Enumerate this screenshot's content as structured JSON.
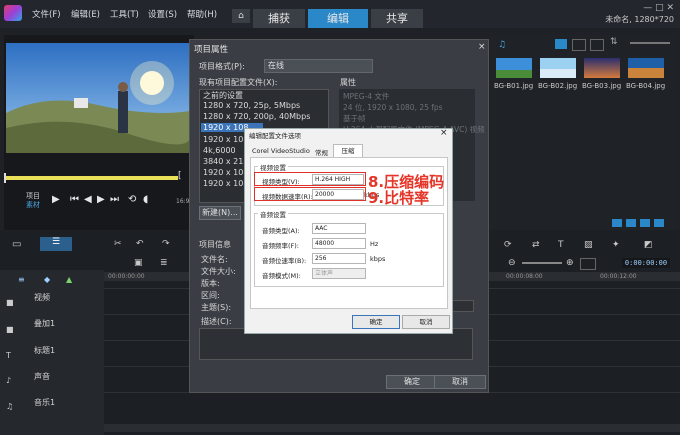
{
  "menubar": {
    "file": "文件(F)",
    "edit": "编辑(E)",
    "tools": "工具(T)",
    "settings": "设置(S)",
    "help": "帮助(H)"
  },
  "tabs": [
    {
      "label": "捕获"
    },
    {
      "label": "编辑"
    },
    {
      "label": "共享"
    }
  ],
  "project_name": "未命名, 1280*720",
  "window_controls": "— □ ✕",
  "preview": {
    "project_label": "项目",
    "clip_label": "素材",
    "time": "16:9"
  },
  "library": {
    "thumbs": [
      {
        "label": "BG-B01.jpg"
      },
      {
        "label": "BG-B02.jpg"
      },
      {
        "label": "BG-B03.jpg"
      },
      {
        "label": "BG-B04.jpg"
      }
    ],
    "timecode": "0:00:00:00"
  },
  "timeline": {
    "ruler_start": "00:00:00:00",
    "ruler_mid": "00:00:08:00",
    "ruler_end": "00:00:12:00",
    "tracks": [
      {
        "label": "视频"
      },
      {
        "label": "叠加1"
      },
      {
        "label": "标题1"
      },
      {
        "label": "声音"
      },
      {
        "label": "音乐1"
      }
    ]
  },
  "project_dialog": {
    "title": "项目属性",
    "format_label": "项目格式(P):",
    "format_value": "在线",
    "profiles_label": "现有项目配置文件(X):",
    "props_label": "属性",
    "profiles": [
      {
        "label": "之前的设置"
      },
      {
        "label": "1280 x 720, 25p, 5Mbps"
      },
      {
        "label": "1280 x 720, 200p, 40Mbps"
      },
      {
        "label": "1920 x 108",
        "selected": true
      },
      {
        "label": "1920 x 108"
      },
      {
        "label": "4k,6000"
      },
      {
        "label": "3840 x 216"
      },
      {
        "label": "1920 x 108"
      },
      {
        "label": "1920 x 108"
      }
    ],
    "properties": [
      {
        "label": "MPEG-4 文件"
      },
      {
        "label": "24 位, 1920 x 1080, 25 fps"
      },
      {
        "label": "基于帧"
      },
      {
        "label": "H.264 大都配置文件 (MPEG-4 AVC) 视频"
      }
    ],
    "new_button": "新建(N)...",
    "info_label": "项目信息",
    "fields": [
      {
        "label": "文件名:"
      },
      {
        "label": "文件大小:"
      },
      {
        "label": "版本:"
      },
      {
        "label": "区间:"
      },
      {
        "label": "主题(S):"
      },
      {
        "label": "描述(C):"
      }
    ],
    "ok": "确定",
    "cancel": "取消"
  },
  "codec_dialog": {
    "title": "编辑配置文件选项",
    "tabs": [
      {
        "label": "Corel VideoStudio"
      },
      {
        "label": "常规"
      },
      {
        "label": "压缩"
      }
    ],
    "video_group": "视频设置",
    "video_type_label": "视频类型(V):",
    "video_type_value": "H.264 HIGH",
    "bitrate_label": "视频数据速率(R):",
    "bitrate_value": "20000",
    "bitrate_unit": "kbps",
    "audio_group": "音频设置",
    "audio_type_label": "音频类型(A):",
    "audio_type_value": "AAC",
    "audio_freq_label": "音频频率(F):",
    "audio_freq_value": "48000",
    "audio_freq_unit": "Hz",
    "audio_bitrate_label": "音频位速率(B):",
    "audio_bitrate_value": "256",
    "audio_bitrate_unit": "kbps",
    "audio_mode_label": "音频模式(M):",
    "audio_mode_value": "立体声",
    "ok": "确定",
    "cancel": "取消",
    "close": "×"
  },
  "annotations": {
    "a1": "8.压缩编码",
    "a2": "9.比特率"
  },
  "colors": {
    "accent": "#2b88c8",
    "highlight": "#e0302a"
  }
}
